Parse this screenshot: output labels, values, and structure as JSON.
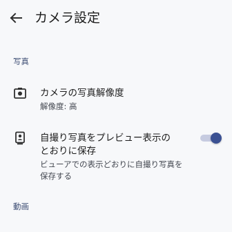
{
  "app_bar": {
    "back_icon": "arrow-back-icon",
    "title": "カメラ設定"
  },
  "sections": [
    {
      "header": "写真",
      "items": [
        {
          "icon": "camera-icon",
          "title": "カメラの写真解像度",
          "summary": "解像度: 高"
        },
        {
          "icon": "portrait-mirror-icon",
          "title_line1": "自撮り写真をプレビュー表示の",
          "title_line2": "とおりに保存",
          "summary_line1": "ビューアでの表示どおりに自撮り写真を",
          "summary_line2": "保存する",
          "toggle_on": true
        }
      ]
    },
    {
      "header": "動画"
    }
  ],
  "colors": {
    "background": "#f7f8fa",
    "section_header": "#3f4f75",
    "toggle_thumb": "#3b5193",
    "toggle_track": "#c6cbe0"
  }
}
